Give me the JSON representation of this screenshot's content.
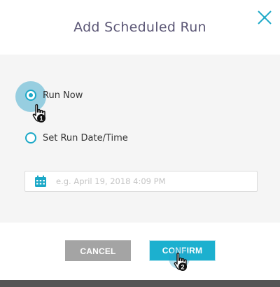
{
  "dialog": {
    "title": "Add Scheduled Run",
    "close_icon": "close-x-icon"
  },
  "schedule_options": [
    {
      "label": "Run Now",
      "selected": true
    },
    {
      "label": "Set Run Date/Time",
      "selected": false
    }
  ],
  "date_field": {
    "icon": "calendar-icon",
    "placeholder": "e.g. April 19, 2018 4:09 PM",
    "value": ""
  },
  "actions": {
    "cancel_label": "CANCEL",
    "confirm_label": "CONFIRM"
  },
  "tutorial_steps": [
    {
      "step": "1",
      "target": "Run Now"
    },
    {
      "step": "2",
      "target": "CONFIRM"
    }
  ],
  "colors": {
    "accent": "#1ba8c7",
    "cancel": "#a4a4a4",
    "title": "#5b5675"
  }
}
